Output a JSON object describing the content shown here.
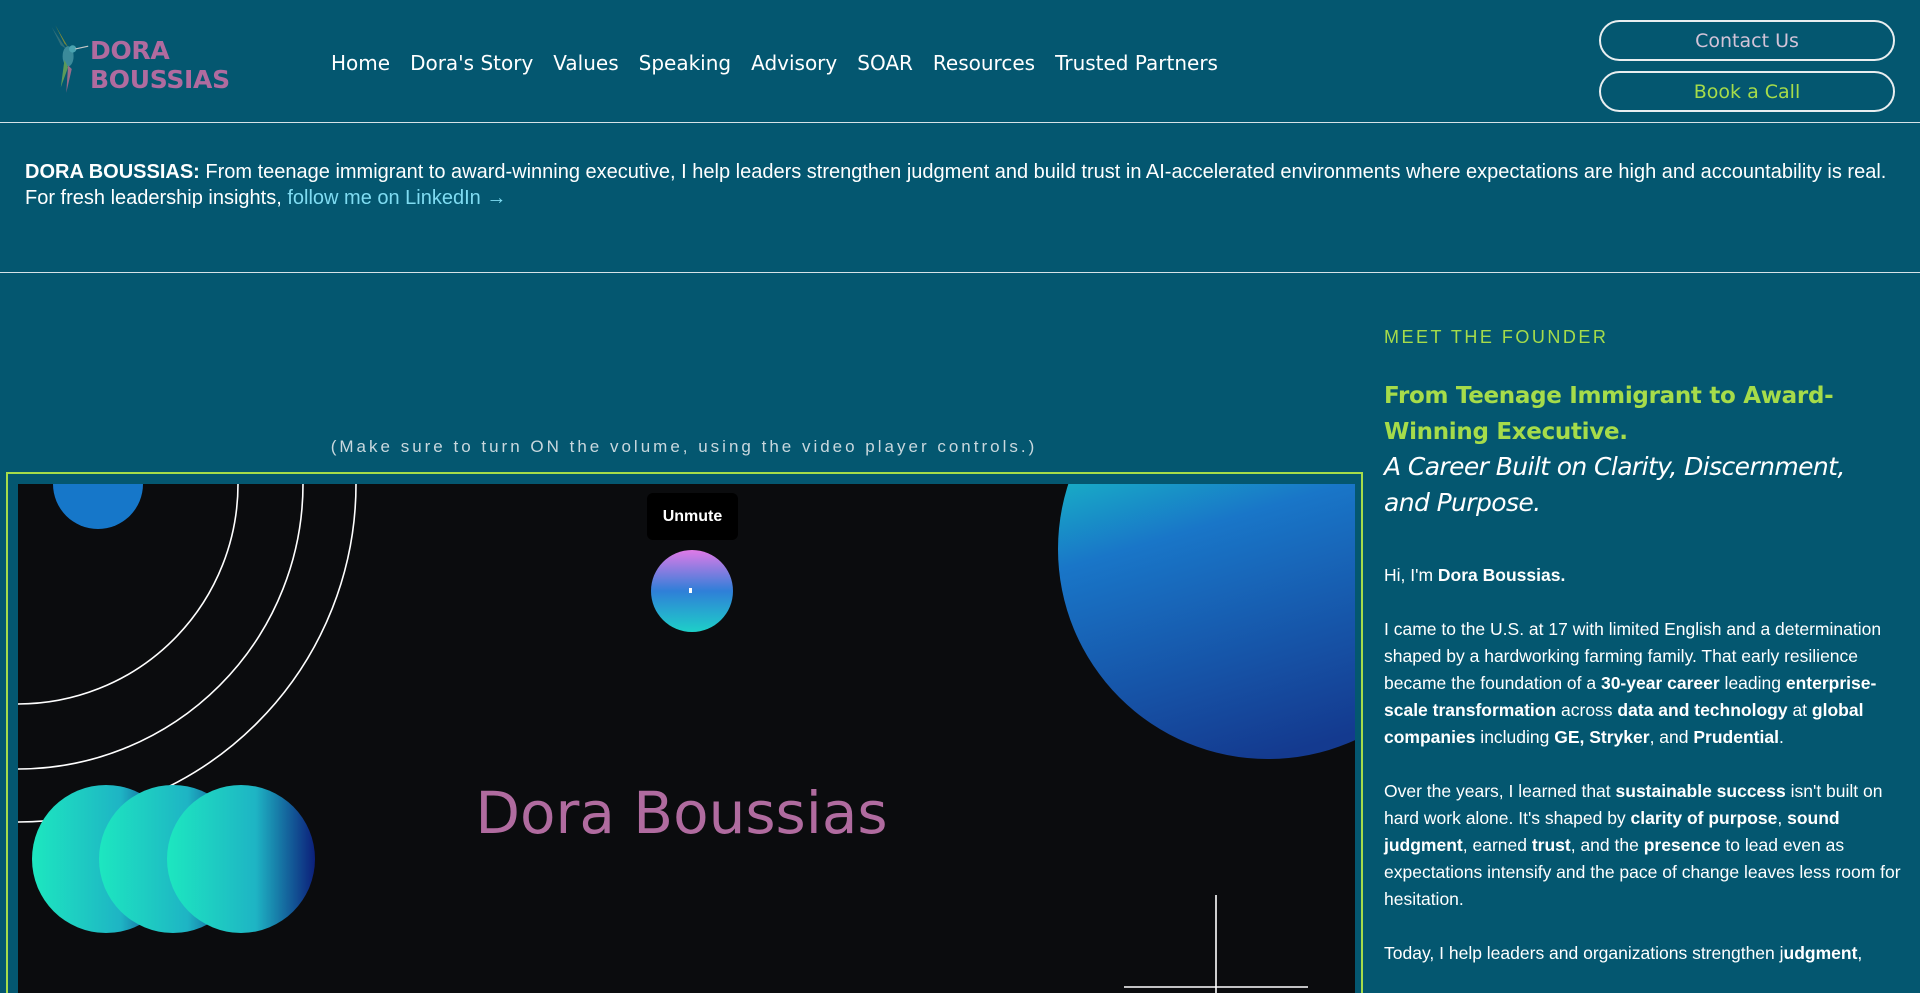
{
  "header": {
    "logo_text": "DORA BOUSSIAS",
    "nav": [
      "Home",
      "Dora's Story",
      "Values",
      "Speaking",
      "Advisory",
      "SOAR",
      "Resources",
      "Trusted Partners"
    ],
    "contact_label": "Contact Us",
    "book_label": "Book a Call"
  },
  "intro": {
    "name": "DORA BOUSSIAS:",
    "tagline": " From teenage immigrant to award-winning executive, I help leaders strengthen judgment and build trust in AI-accelerated environments where expectations are high and accountability is real.",
    "linkedin_prefix": "For fresh leadership insights, ",
    "linkedin_link": "follow me on LinkedIn →"
  },
  "video": {
    "volume_note": "(Make sure to turn ON the volume, using the video player controls.)",
    "unmute_label": "Unmute",
    "title": "Dora Boussias"
  },
  "founder": {
    "eyebrow": "MEET THE FOUNDER",
    "headline": "From Teenage Immigrant to Award-Winning Executive.",
    "subhead": "A Career Built on Clarity, Discernment, and Purpose.",
    "p1": [
      {
        "t": "Hi, I'm ",
        "b": false
      },
      {
        "t": "Dora Boussias.",
        "b": true
      }
    ],
    "p2": [
      {
        "t": "I came to the U.S. at 17 with limited English and a determination shaped by a hardworking farming family. That early resilience became the foundation of a ",
        "b": false
      },
      {
        "t": "30-year career",
        "b": true
      },
      {
        "t": " leading ",
        "b": false
      },
      {
        "t": "enterprise-scale transformation",
        "b": true
      },
      {
        "t": " across ",
        "b": false
      },
      {
        "t": "data and technology",
        "b": true
      },
      {
        "t": " at ",
        "b": false
      },
      {
        "t": "global companies",
        "b": true
      },
      {
        "t": " including ",
        "b": false
      },
      {
        "t": "GE, Stryker",
        "b": true
      },
      {
        "t": ", and ",
        "b": false
      },
      {
        "t": "Prudential",
        "b": true
      },
      {
        "t": ".",
        "b": false
      }
    ],
    "p3": [
      {
        "t": "Over the years, I learned that ",
        "b": false
      },
      {
        "t": "sustainable success",
        "b": true
      },
      {
        "t": " isn't built on hard work alone. It's shaped by ",
        "b": false
      },
      {
        "t": "clarity of purpose",
        "b": true
      },
      {
        "t": ", ",
        "b": false
      },
      {
        "t": "sound judgment",
        "b": true
      },
      {
        "t": ", earned ",
        "b": false
      },
      {
        "t": "trust",
        "b": true
      },
      {
        "t": ", and the ",
        "b": false
      },
      {
        "t": "presence",
        "b": true
      },
      {
        "t": " to lead even as expectations intensify and the pace of change leaves less room for hesitation.",
        "b": false
      }
    ],
    "p4": [
      {
        "t": "Today, I help leaders and organizations strengthen j",
        "b": false
      },
      {
        "t": "udgment",
        "b": true
      },
      {
        "t": ",",
        "b": false
      }
    ]
  },
  "colors": {
    "background": "#045770",
    "accent_green": "#a6dc4a",
    "brand_pink": "#b06b9f",
    "link_blue": "#7fdcf2"
  }
}
